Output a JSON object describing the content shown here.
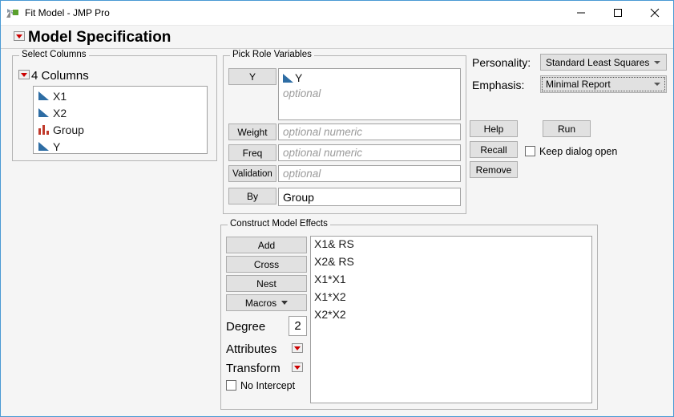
{
  "window": {
    "title": "Fit Model - JMP Pro",
    "app_icon": "jmp-icon",
    "minimize_label": "Minimize",
    "maximize_label": "Maximize",
    "close_label": "Close"
  },
  "spec_header": {
    "title": "Model Specification",
    "disclosure_icon": "disclosure-triangle-icon",
    "popup_icon": "red-popup-icon"
  },
  "select_columns": {
    "legend": "Select Columns",
    "popup_icon": "red-popup-icon",
    "count_label": "4 Columns",
    "columns": [
      {
        "name": "X1",
        "icon": "continuous-icon"
      },
      {
        "name": "X2",
        "icon": "continuous-icon"
      },
      {
        "name": "Group",
        "icon": "nominal-icon"
      },
      {
        "name": "Y",
        "icon": "continuous-icon"
      }
    ]
  },
  "pick_roles": {
    "legend": "Pick Role Variables",
    "y": {
      "button": "Y",
      "value": "Y",
      "value_icon": "continuous-icon",
      "placeholder": "optional"
    },
    "weight": {
      "button": "Weight",
      "value": "",
      "placeholder": "optional numeric"
    },
    "freq": {
      "button": "Freq",
      "value": "",
      "placeholder": "optional numeric"
    },
    "validation": {
      "button": "Validation",
      "value": "",
      "placeholder": "optional"
    },
    "by": {
      "button": "By",
      "value": "Group",
      "placeholder": "optional"
    }
  },
  "options": {
    "personality_label": "Personality:",
    "personality_value": "Standard Least Squares",
    "emphasis_label": "Emphasis:",
    "emphasis_value": "Minimal Report",
    "help_label": "Help",
    "run_label": "Run",
    "recall_label": "Recall",
    "remove_label": "Remove",
    "keep_dialog_open_label": "Keep dialog open",
    "keep_dialog_open_checked": false
  },
  "construct_effects": {
    "legend": "Construct Model Effects",
    "add_label": "Add",
    "cross_label": "Cross",
    "nest_label": "Nest",
    "macros_label": "Macros",
    "degree_label": "Degree",
    "degree_value": "2",
    "attributes_label": "Attributes",
    "transform_label": "Transform",
    "no_intercept_label": "No Intercept",
    "no_intercept_checked": false,
    "effects": [
      "X1& RS",
      "X2& RS",
      "X1*X1",
      "X1*X2",
      "X2*X2"
    ]
  },
  "colors": {
    "accent": "#cc0000",
    "continuous_icon": "#2e6da4",
    "nominal_icon": "#c0392b",
    "window_border": "#4a9ad4",
    "dialog_bg": "#f5f5f5"
  }
}
